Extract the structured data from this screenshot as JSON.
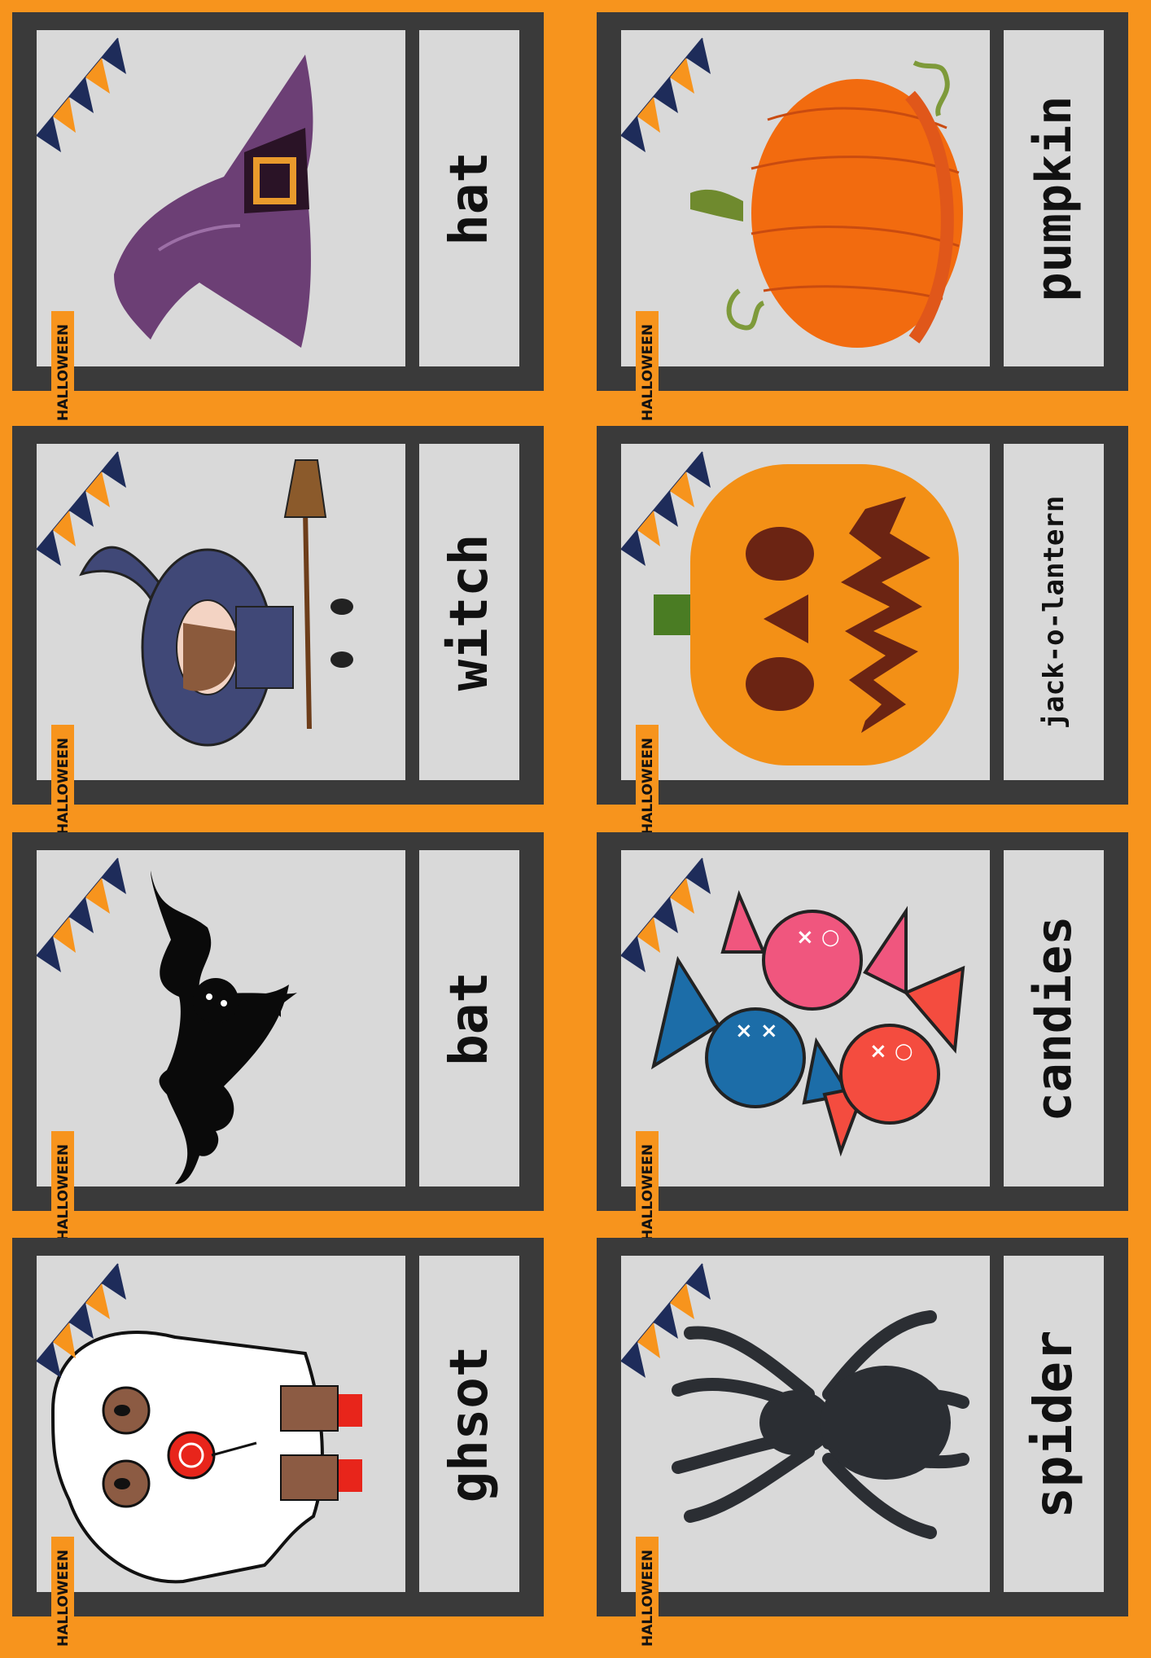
{
  "badge_text": "HALLOWEEN",
  "cards": [
    {
      "id": "hat",
      "label": "hat",
      "icon": "witch-hat-icon"
    },
    {
      "id": "witch",
      "label": "witch",
      "icon": "witch-icon"
    },
    {
      "id": "bat",
      "label": "bat",
      "icon": "bat-icon"
    },
    {
      "id": "ghost",
      "label": "ghsot",
      "icon": "ghost-icon"
    },
    {
      "id": "pumpkin",
      "label": "pumpkin",
      "icon": "pumpkin-icon"
    },
    {
      "id": "jack",
      "label": "jack-o-lantern",
      "icon": "jack-o-lantern-icon"
    },
    {
      "id": "candies",
      "label": "candies",
      "icon": "candies-icon"
    },
    {
      "id": "spider",
      "label": "spider",
      "icon": "spider-icon"
    }
  ],
  "colors": {
    "background": "#F7941D",
    "card_frame": "#3A3A3A",
    "panel": "#D9D9D9"
  }
}
